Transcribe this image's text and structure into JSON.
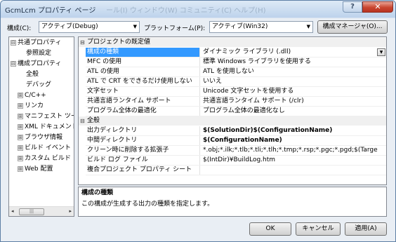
{
  "window": {
    "title": "GcmLcm プロパティ ページ",
    "background_title_text": "ール(I)  ウィンドウ(W)  コミュニティ(C)  ヘルプ(H)",
    "help_glyph": "?",
    "close_glyph": "✕"
  },
  "toolbar": {
    "config_label": "構成(C):",
    "config_value": "アクティブ(Debug)",
    "platform_label": "プラットフォーム(P):",
    "platform_value": "アクティブ(Win32)",
    "manager_button": "構成マネージャ(O)..."
  },
  "tree": {
    "items": [
      {
        "label": "共通プロパティ",
        "expander": "⊟",
        "indent": 0
      },
      {
        "label": "参照設定",
        "expander": "",
        "indent": 1
      },
      {
        "label": "構成プロパティ",
        "expander": "⊟",
        "indent": 0
      },
      {
        "label": "全般",
        "expander": "",
        "indent": 1
      },
      {
        "label": "デバッグ",
        "expander": "",
        "indent": 1
      },
      {
        "label": "C/C++",
        "expander": "⊞",
        "indent": 1
      },
      {
        "label": "リンカ",
        "expander": "⊞",
        "indent": 1
      },
      {
        "label": "マニフェスト ツー",
        "expander": "⊞",
        "indent": 1
      },
      {
        "label": "XML ドキュメント",
        "expander": "⊞",
        "indent": 1
      },
      {
        "label": "ブラウザ情報",
        "expander": "⊞",
        "indent": 1
      },
      {
        "label": "ビルド イベント",
        "expander": "⊞",
        "indent": 1
      },
      {
        "label": "カスタム ビルド",
        "expander": "⊞",
        "indent": 1
      },
      {
        "label": "Web 配置",
        "expander": "⊞",
        "indent": 1
      }
    ],
    "scroll_left": "◂",
    "scroll_right": "▸",
    "scroll_grip": "|||"
  },
  "grid": {
    "sections": [
      {
        "title": "プロジェクトの既定値",
        "toggle": "⊟",
        "rows": [
          {
            "key": "構成の種類",
            "value": "ダイナミック ライブラリ (.dll)",
            "bold": false,
            "selected": true
          },
          {
            "key": "MFC の使用",
            "value": "標準 Windows ライブラリを使用する",
            "bold": false
          },
          {
            "key": "ATL の使用",
            "value": "ATL を使用しない",
            "bold": false
          },
          {
            "key": "ATL で CRT をできるだけ使用しない",
            "value": "いいえ",
            "bold": false
          },
          {
            "key": "文字セット",
            "value": "Unicode 文字セットを使用する",
            "bold": false
          },
          {
            "key": "共通言語ランタイム サポート",
            "value": "共通言語ランタイム サポート (/clr)",
            "bold": false
          },
          {
            "key": "プログラム全体の最適化",
            "value": "プログラム全体の最適化なし",
            "bold": false
          }
        ]
      },
      {
        "title": "全般",
        "toggle": "⊟",
        "rows": [
          {
            "key": "出力ディレクトリ",
            "value": "$(SolutionDir)$(ConfigurationName)",
            "bold": true
          },
          {
            "key": "中間ディレクトリ",
            "value": "$(ConfigurationName)",
            "bold": true
          },
          {
            "key": "クリーン時に削除する拡張子",
            "value": "*.obj;*.ilk;*.tlb;*.tli;*.tlh;*.tmp;*.rsp;*.pgc;*.pgd;$(Targe",
            "bold": false
          },
          {
            "key": "ビルド ログ ファイル",
            "value": "$(IntDir)¥BuildLog.htm",
            "bold": false
          },
          {
            "key": "複合プロジェクト プロパティ シート",
            "value": "",
            "bold": false
          }
        ]
      }
    ],
    "dropdown_glyph": "▼"
  },
  "description": {
    "title": "構成の種類",
    "text": "この構成が生成する出力の種類を指定します。"
  },
  "buttons": {
    "ok": "OK",
    "cancel": "キャンセル",
    "apply": "適用(A)"
  }
}
